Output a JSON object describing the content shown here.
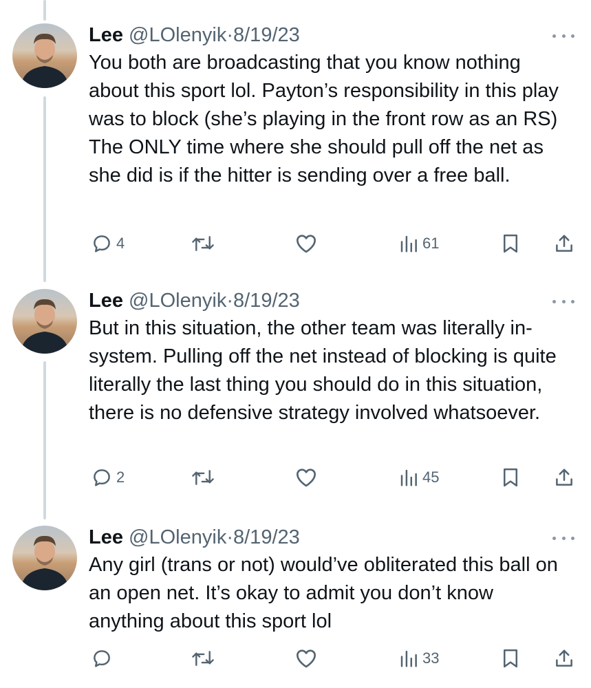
{
  "tweets": [
    {
      "name": "Lee",
      "handle": "@LOlenyik",
      "separator": "·",
      "date": "8/19/23",
      "text": "You both are broadcasting that you know nothing about this sport lol. Payton’s responsibility in this play was to block (she’s playing in the front row as an RS) The ONLY time where she should pull off the net as she did is if the hitter is sending over a free ball.",
      "replies": "4",
      "views": "61"
    },
    {
      "name": "Lee",
      "handle": "@LOlenyik",
      "separator": "·",
      "date": "8/19/23",
      "text": "But in this situation, the other team was literally in-system. Pulling off the net instead of blocking is quite literally the last thing you should do in this situation, there is no defensive strategy involved whatsoever.",
      "replies": "2",
      "views": "45"
    },
    {
      "name": "Lee",
      "handle": "@LOlenyik",
      "separator": "·",
      "date": "8/19/23",
      "text": "Any girl (trans or not) would’ve obliterated this ball on an open net. It’s okay to admit you don’t know anything about this sport lol",
      "replies": "",
      "views": "33"
    }
  ],
  "icons": {
    "reply": "reply-icon",
    "retweet": "retweet-icon",
    "like": "heart-icon",
    "views": "views-icon",
    "bookmark": "bookmark-icon",
    "share": "share-icon",
    "more": "more-icon"
  },
  "colors": {
    "text": "#0f1419",
    "secondary": "#536471",
    "thread_line": "#cfd9de"
  }
}
